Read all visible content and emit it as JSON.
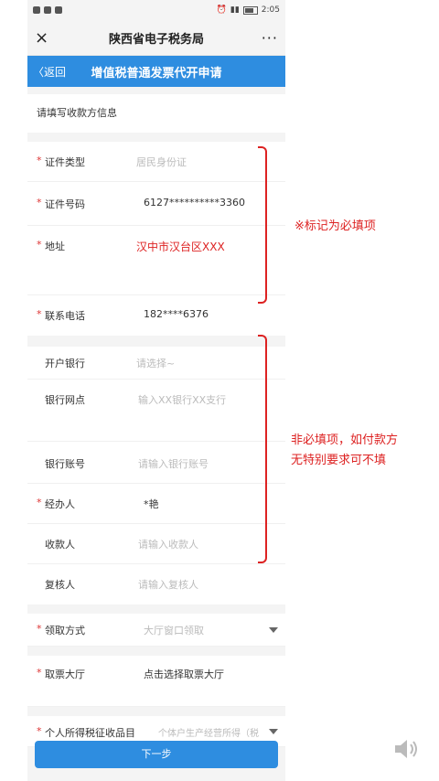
{
  "status": {
    "time": "2:05"
  },
  "window": {
    "close_icon": "×",
    "title": "陕西省电子税务局",
    "more": "···"
  },
  "nav": {
    "back": "〈返回",
    "title": "增值税普通发票代开申请"
  },
  "section_title": "请填写收款方信息",
  "required_group": [
    {
      "label": "证件类型",
      "value": "居民身份证",
      "placeholder": true,
      "required": true
    },
    {
      "label": "证件号码",
      "value": "6127**********3360",
      "placeholder": false,
      "required": true
    },
    {
      "label": "地址",
      "value": "汉中市汉台区XXX",
      "placeholder": false,
      "required": true,
      "annotated": true
    },
    {
      "label": "联系电话",
      "value": "182****6376",
      "placeholder": false,
      "required": true
    }
  ],
  "optional_group": [
    {
      "label": "开户银行",
      "value": "请选择~",
      "placeholder": true,
      "required": false
    },
    {
      "label": "银行网点",
      "value": "输入XX银行XX支行",
      "placeholder": true,
      "required": false
    },
    {
      "label": "银行账号",
      "value": "请输入银行账号",
      "placeholder": true,
      "required": false
    },
    {
      "label": "经办人",
      "value": "*艳",
      "placeholder": false,
      "required": true
    },
    {
      "label": "收款人",
      "value": "请输入收款人",
      "placeholder": true,
      "required": false
    },
    {
      "label": "复核人",
      "value": "请输入复核人",
      "placeholder": true,
      "required": false
    }
  ],
  "lower_group": [
    {
      "label": "领取方式",
      "value": "大厅窗口领取",
      "placeholder": true,
      "required": true,
      "dropdown": true
    },
    {
      "label": "取票大厅",
      "value": "点击选择取票大厅",
      "placeholder": false,
      "required": true
    },
    {
      "label": "个人所得税征收品目",
      "value": "个体户生产经营所得（税",
      "placeholder": true,
      "required": true,
      "dropdown": true
    }
  ],
  "annotations": {
    "required_note": "※标记为必填项",
    "optional_note_line1": "非必填项，如付款方",
    "optional_note_line2": "无特别要求可不填"
  },
  "next_button": "下一步",
  "colors": {
    "primary": "#2e8de0",
    "annotation": "#d22222",
    "required": "#dd3333"
  }
}
